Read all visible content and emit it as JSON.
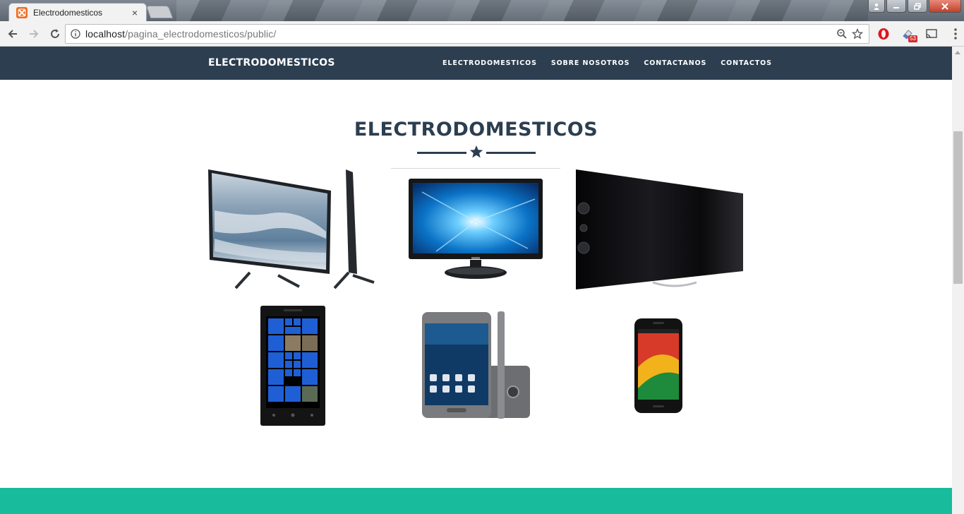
{
  "browser": {
    "tab_title": "Electrodomesticos",
    "tab_close": "×",
    "url_host": "localhost",
    "url_path": "/pagina_electrodomesticos/public/",
    "extension_badge": "53"
  },
  "navbar": {
    "brand": "ELECTRODOMESTICOS",
    "links": [
      "ELECTRODOMESTICOS",
      "SOBRE NOSOTROS",
      "CONTACTANOS",
      "CONTACTOS"
    ]
  },
  "section": {
    "title": "ELECTRODOMESTICOS",
    "divider_icon": "star-icon"
  },
  "products": [
    {
      "name": "tv-samsung-curved"
    },
    {
      "name": "monitor-samsung"
    },
    {
      "name": "tv-sony-bravia"
    },
    {
      "name": "phone-nokia-lumia"
    },
    {
      "name": "phone-samsung-galaxy"
    },
    {
      "name": "phone-motorola-moto-g"
    }
  ],
  "colors": {
    "primary": "#2c3e50",
    "accent": "#18bc9c",
    "tab_favicon": "#f26b1d"
  }
}
